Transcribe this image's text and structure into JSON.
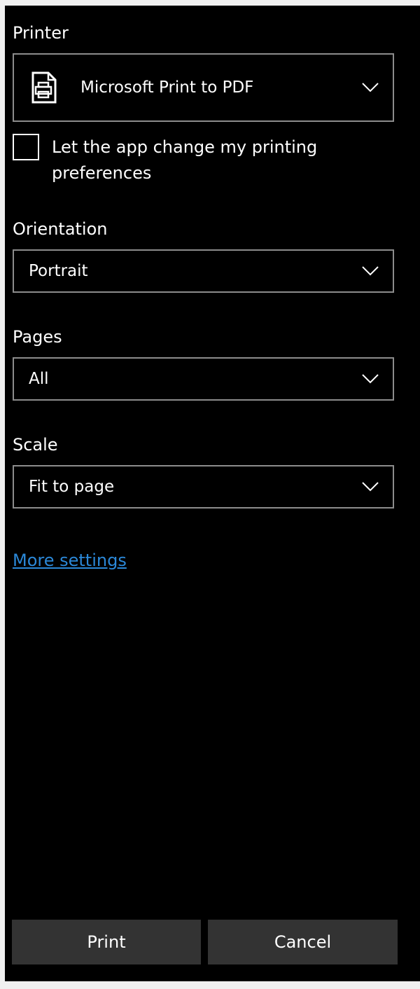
{
  "printer": {
    "label": "Printer",
    "selected": "Microsoft Print to PDF",
    "icon": "printer-icon"
  },
  "preferences": {
    "checkbox_label": "Let the app change my printing preferences",
    "checked": false
  },
  "orientation": {
    "label": "Orientation",
    "selected": "Portrait"
  },
  "pages": {
    "label": "Pages",
    "selected": "All"
  },
  "scale": {
    "label": "Scale",
    "selected": "Fit to page"
  },
  "more_settings": {
    "label": "More settings"
  },
  "buttons": {
    "print": "Print",
    "cancel": "Cancel"
  },
  "colors": {
    "background": "#000000",
    "text": "#ffffff",
    "link": "#2b88d8",
    "button": "#333333",
    "border": "#8c8c8c"
  }
}
